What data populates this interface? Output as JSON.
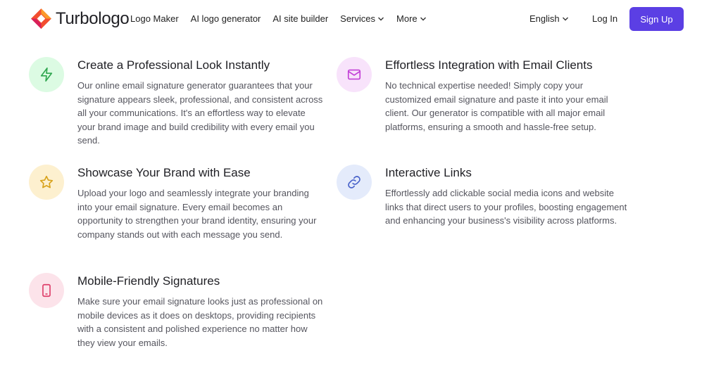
{
  "header": {
    "logo_text": "Turbologo",
    "nav": [
      {
        "label": "Logo Maker",
        "has_dropdown": false
      },
      {
        "label": "AI logo generator",
        "has_dropdown": false
      },
      {
        "label": "AI site builder",
        "has_dropdown": false
      },
      {
        "label": "Services",
        "has_dropdown": true
      },
      {
        "label": "More",
        "has_dropdown": true
      }
    ],
    "language": "English",
    "login_label": "Log In",
    "signup_label": "Sign Up"
  },
  "features": [
    {
      "icon": "lightning-icon",
      "icon_bg": "#dcfbe3",
      "icon_color": "#2fa64f",
      "title": "Create a Professional Look Instantly",
      "description": "Our online email signature generator guarantees that your signature appears sleek, professional, and consistent across all your communications. It's an effortless way to elevate your brand image and build credibility with every email you send."
    },
    {
      "icon": "mail-icon",
      "icon_bg": "#f8e3fb",
      "icon_color": "#c23fd6",
      "title": "Effortless Integration with Email Clients",
      "description": "No technical expertise needed! Simply copy your customized email signature and paste it into your email client. Our generator is compatible with all major email platforms, ensuring a smooth and hassle-free setup."
    },
    {
      "icon": "star-icon",
      "icon_bg": "#fdf0cf",
      "icon_color": "#d8a21a",
      "title": "Showcase Your Brand with Ease",
      "description": "Upload your logo and seamlessly integrate your branding into your email signature. Every email becomes an opportunity to strengthen your brand identity, ensuring your company stands out with each message you send."
    },
    {
      "icon": "link-icon",
      "icon_bg": "#e4ebfb",
      "icon_color": "#4660c9",
      "title": "Interactive Links",
      "description": "Effortlessly add clickable social media icons and website links that direct users to your profiles, boosting engagement and enhancing your business's visibility across platforms."
    },
    {
      "icon": "mobile-icon",
      "icon_bg": "#fce3ea",
      "icon_color": "#de3f6a",
      "title": "Mobile-Friendly Signatures",
      "description": "Make sure your email signature looks just as professional on mobile devices as it does on desktops, providing recipients with a consistent and polished experience no matter how they view your emails."
    }
  ],
  "colors": {
    "accent": "#5b3fe4"
  }
}
